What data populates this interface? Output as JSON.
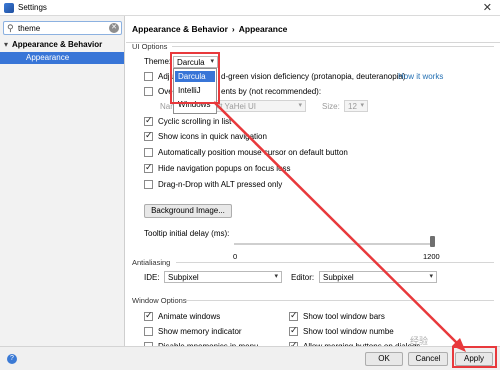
{
  "window": {
    "title": "Settings"
  },
  "search": {
    "value": "theme"
  },
  "tree": {
    "parent": "Appearance & Behavior",
    "child": "Appearance"
  },
  "breadcrumb": {
    "part1": "Appearance & Behavior",
    "separator": "›",
    "part2": "Appearance"
  },
  "ui_options": {
    "group": "UI Options",
    "theme_label": "Theme:",
    "theme_value": "Darcula",
    "theme_options": [
      "Darcula",
      "IntelliJ",
      "Windows"
    ],
    "adjust_colors_label_visible": "Adju",
    "adjust_colors_label_rest": "d-green vision deficiency (protanopia, deuteranopia)",
    "how_it_works": "How it works",
    "override_font_label_visible": "Ove",
    "override_font_label_rest": "ents by (not recommended):",
    "name_label": "Name:",
    "font_name": "Microsoft YaHei UI",
    "size_label": "Size:",
    "font_size": "12",
    "cyclic_scrolling": "Cyclic scrolling in list",
    "show_icons": "Show icons in quick navigation",
    "auto_position": "Automatically position mouse cursor on default button",
    "hide_popups": "Hide navigation popups on focus loss",
    "drag_drop": "Drag-n-Drop with ALT pressed only",
    "background_image": "Background Image...",
    "tooltip_delay": "Tooltip initial delay (ms):",
    "slider_min": "0",
    "slider_max": "1200",
    "tooltip_delay_value": 1200
  },
  "antialiasing": {
    "group": "Antialiasing",
    "ide_label": "IDE:",
    "ide_value": "Subpixel",
    "editor_label": "Editor:",
    "editor_value": "Subpixel"
  },
  "window_options": {
    "group": "Window Options",
    "animate_windows": "Animate windows",
    "show_memory": "Show memory indicator",
    "disable_mnemonics": "Disable mnemonics in menu",
    "show_tool_window_bars": "Show tool window bars",
    "show_tool_window_numbers": "Show tool window numbe",
    "allow_merging": "Allow merging buttons on dialogs"
  },
  "footer": {
    "help": "?",
    "ok": "OK",
    "cancel": "Cancel",
    "apply": "Apply"
  },
  "watermark": "经验",
  "colors": {
    "selection": "#3875d7",
    "annotation": "#e8393c",
    "link": "#2470b3"
  }
}
